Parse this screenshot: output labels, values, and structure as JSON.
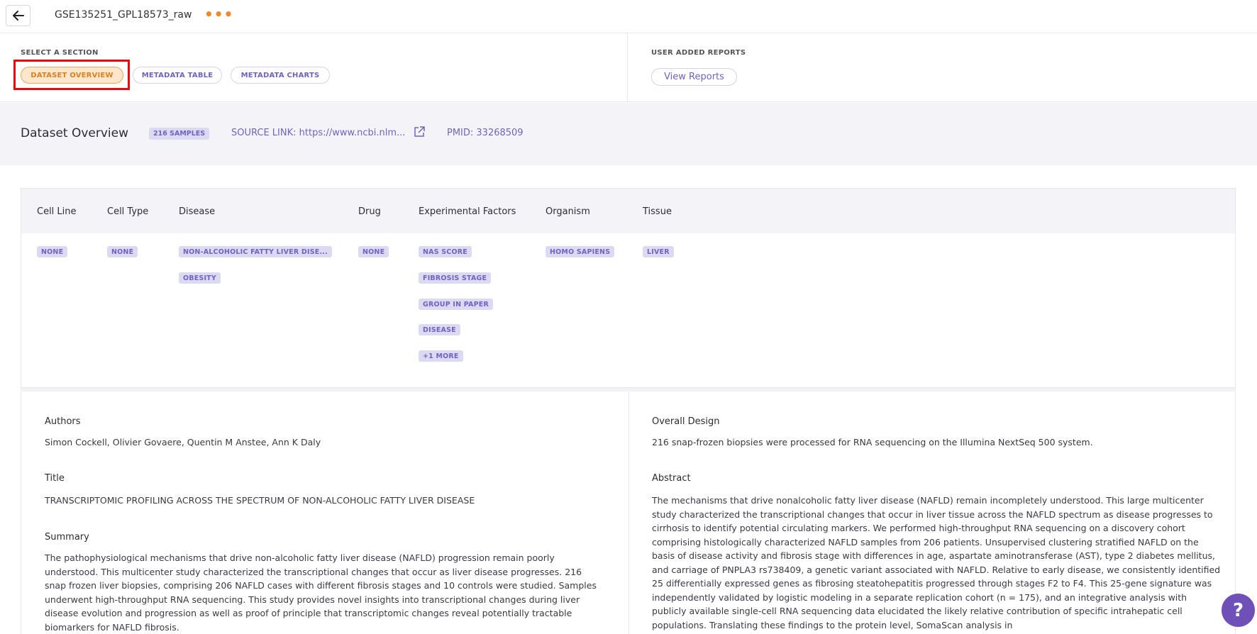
{
  "header": {
    "dataset_title": "GSE135251_GPL18573_raw",
    "more_label": "•••"
  },
  "section_selector": {
    "heading": "SELECT A SECTION",
    "tabs": [
      {
        "label": "DATASET OVERVIEW",
        "active": true
      },
      {
        "label": "METADATA TABLE",
        "active": false
      },
      {
        "label": "METADATA CHARTS",
        "active": false
      }
    ]
  },
  "reports": {
    "heading": "USER ADDED REPORTS",
    "view_label": "View Reports"
  },
  "overview": {
    "title": "Dataset Overview",
    "samples_badge": "216 SAMPLES",
    "source_link": "SOURCE LINK: https://www.ncbi.nlm...",
    "pmid": "PMID: 33268509"
  },
  "metadata": {
    "columns": [
      {
        "header": "Cell Line",
        "tags": [
          "NONE"
        ]
      },
      {
        "header": "Cell Type",
        "tags": [
          "NONE"
        ]
      },
      {
        "header": "Disease",
        "tags": [
          "NON-ALCOHOLIC FATTY LIVER DISE...",
          "OBESITY"
        ]
      },
      {
        "header": "Drug",
        "tags": [
          "NONE"
        ]
      },
      {
        "header": "Experimental Factors",
        "tags": [
          "NAS SCORE",
          "FIBROSIS STAGE",
          "GROUP IN PAPER",
          "DISEASE",
          "+1 MORE"
        ]
      },
      {
        "header": "Organism",
        "tags": [
          "HOMO SAPIENS"
        ]
      },
      {
        "header": "Tissue",
        "tags": [
          "LIVER"
        ]
      }
    ]
  },
  "details": {
    "authors_label": "Authors",
    "authors": "Simon Cockell, Olivier Govaere, Quentin M Anstee, Ann K Daly",
    "title_label": "Title",
    "title": "TRANSCRIPTOMIC PROFILING ACROSS THE SPECTRUM OF NON-ALCOHOLIC FATTY LIVER DISEASE",
    "summary_label": "Summary",
    "summary": "The pathophysiological mechanisms that drive non-alcoholic fatty liver disease (NAFLD) progression remain poorly understood. This multicenter study characterized the transcriptional changes that occur as liver disease progresses. 216 snap frozen liver biopsies, comprising 206 NAFLD cases with different fibrosis stages and 10 controls were studied. Samples underwent high-throughput RNA sequencing. This study provides novel insights into transcriptional changes during liver disease evolution and progression as well as proof of principle that transcriptomic changes reveal potentially tractable biomarkers for NAFLD fibrosis.",
    "design_label": "Overall Design",
    "design": "216 snap-frozen biopsies were processed for RNA sequencing on the Illumina NextSeq 500 system.",
    "abstract_label": "Abstract",
    "abstract": "The mechanisms that drive nonalcoholic fatty liver disease (NAFLD) remain incompletely understood. This large multicenter study characterized the transcriptional changes that occur in liver tissue across the NAFLD spectrum as disease progresses to cirrhosis to identify potential circulating markers. We performed high-throughput RNA sequencing on a discovery cohort comprising histologically characterized NAFLD samples from 206 patients. Unsupervised clustering stratified NAFLD on the basis of disease activity and fibrosis stage with differences in age, aspartate aminotransferase (AST), type 2 diabetes mellitus, and carriage of PNPLA3 rs738409, a genetic variant associated with NAFLD. Relative to early disease, we consistently identified 25 differentially expressed genes as fibrosing steatohepatitis progressed through stages F2 to F4. This 25-gene signature was independently validated by logistic modeling in a separate replication cohort (n = 175), and an integrative analysis with publicly available single-cell RNA sequencing data elucidated the likely relative contribution of specific intrahepatic cell populations. Translating these findings to the protein level, SomaScan analysis in"
  },
  "help": {
    "label": "?"
  },
  "colors": {
    "accent": "#6f63c2",
    "active": "#e07f1d",
    "highlight": "#e40d0d"
  }
}
